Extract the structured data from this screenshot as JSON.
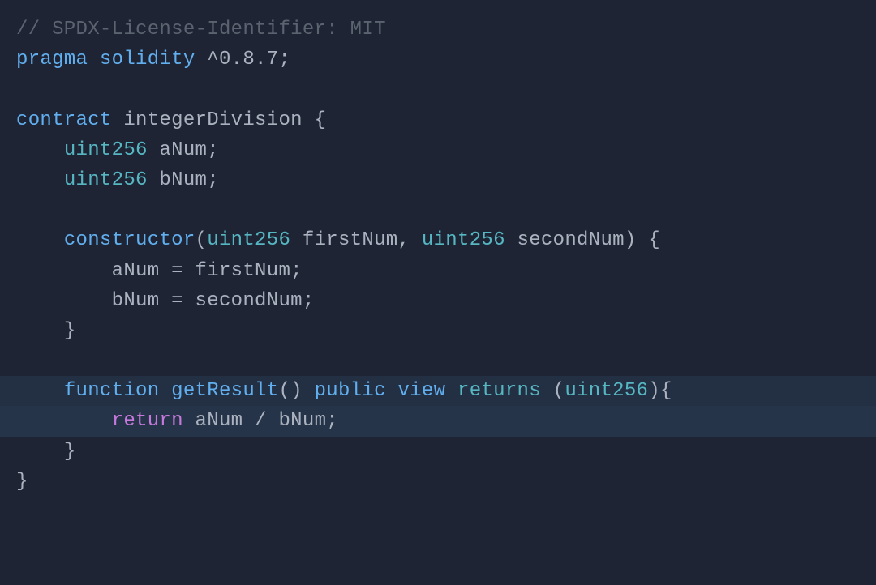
{
  "code": {
    "line1_comment": "// SPDX-License-Identifier: MIT",
    "line2_pragma": "pragma",
    "line2_solidity": "solidity",
    "line2_version": "^0.8.7",
    "line2_semi": ";",
    "line4_contract": "contract",
    "line4_name": "integerDivision",
    "line4_brace": " {",
    "line5_indent": "    ",
    "line5_type": "uint256",
    "line5_var": " aNum",
    "line5_semi": ";",
    "line6_indent": "    ",
    "line6_type": "uint256",
    "line6_var": " bNum",
    "line6_semi": ";",
    "line8_indent": "    ",
    "line8_constructor": "constructor",
    "line8_paren": "(",
    "line8_t1": "uint256",
    "line8_p1": " firstNum",
    "line8_comma": ", ",
    "line8_t2": "uint256",
    "line8_p2": " secondNum",
    "line8_close": ") {",
    "line9_indent": "        ",
    "line9_body": "aNum = firstNum;",
    "line10_indent": "        ",
    "line10_body": "bNum = secondNum;",
    "line11_indent": "    ",
    "line11_brace": "}",
    "line13_indent": "    ",
    "line13_function": "function",
    "line13_name": " getResult",
    "line13_parens": "() ",
    "line13_public": "public",
    "line13_sp1": " ",
    "line13_view": "view",
    "line13_sp2": " ",
    "line13_returns": "returns",
    "line13_sp3": " (",
    "line13_rtype": "uint256",
    "line13_end": "){",
    "line14_indent": "        ",
    "line14_return": "return",
    "line14_expr": " aNum / bNum;",
    "line15_indent": "    ",
    "line15_brace": "}",
    "line16_brace": "}"
  }
}
